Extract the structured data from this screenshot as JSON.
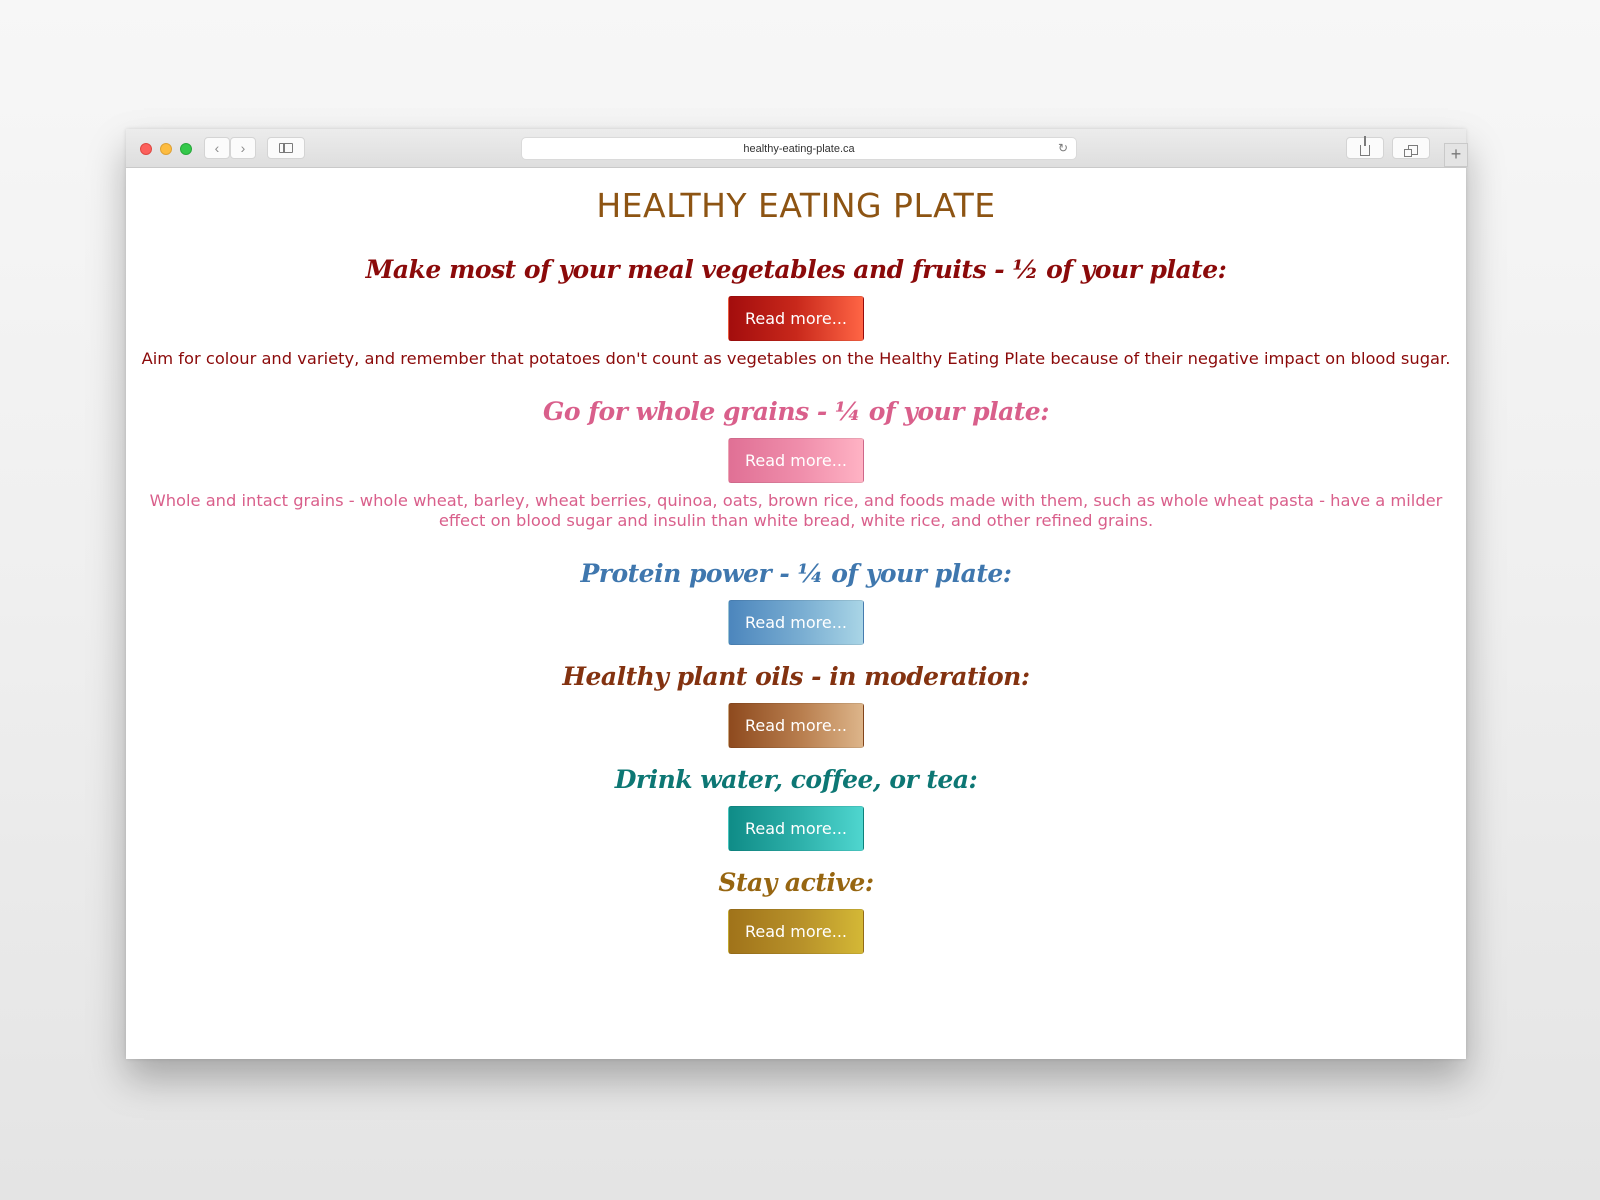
{
  "browser": {
    "url": "healthy-eating-plate.ca",
    "icons": {
      "close": "close-dot",
      "minimize": "minimize-dot",
      "zoom": "zoom-dot",
      "back": "chevron-left-icon",
      "forward": "chevron-right-icon",
      "sidebar": "sidebar-icon",
      "reload": "reload-icon",
      "share": "share-icon",
      "tabs": "tabs-icon",
      "new_tab": "plus-icon"
    },
    "new_tab_glyph": "+",
    "back_glyph": "‹",
    "forward_glyph": "›",
    "reload_glyph": "↻"
  },
  "page": {
    "title": "HEALTHY EATING PLATE",
    "title_color": "#8d5413",
    "sections": [
      {
        "heading": "Make most of your meal vegetables and fruits - ½ of your plate:",
        "button_label": "Read more...",
        "text": "Aim for colour and variety, and remember that potatoes don't count as vegetables on the Healthy Eating Plate because of their negative impact on blood sugar.",
        "color": "#8b0a0a"
      },
      {
        "heading": "Go for whole grains - ¼ of your plate:",
        "button_label": "Read more...",
        "text": "Whole and intact grains - whole wheat, barley, wheat berries, quinoa, oats, brown rice, and foods made with them, such as whole wheat pasta - have a milder effect on blood sugar and insulin than white bread, white rice, and other refined grains.",
        "color": "#d95f8b"
      },
      {
        "heading": "Protein power - ¼ of your plate:",
        "button_label": "Read more...",
        "color": "#3f77ae"
      },
      {
        "heading": "Healthy plant oils - in moderation:",
        "button_label": "Read more...",
        "color": "#833210"
      },
      {
        "heading": "Drink water, coffee, or tea:",
        "button_label": "Read more...",
        "color": "#0d7774"
      },
      {
        "heading": "Stay active:",
        "button_label": "Read more...",
        "color": "#976611"
      }
    ]
  }
}
